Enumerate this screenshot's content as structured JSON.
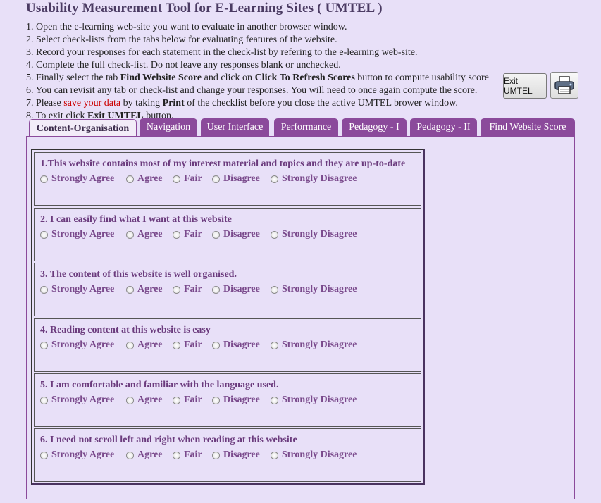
{
  "title": "Usability Measurement Tool for E-Learning Sites ( UMTEL )",
  "instructions": {
    "l1": "1. Open the e-learning web-site you want to evaluate in another browser window.",
    "l2": "2. Select check-lists from the tabs below for evaluating features of the website.",
    "l3": "3. Record your responses for each statement in the check-list by refering to the e-learning web-site.",
    "l4": "4. Complete the full check-list. Do not leave any responses blank or unchecked.",
    "l5a": "5. Finally select the tab ",
    "l5b": "Find Website Score",
    "l5c": " and click on ",
    "l5d": "Click To Refresh Scores",
    "l5e": " button to compute usability score",
    "l6": "6. You can revisit any tab or check-list and change your responses. You will need to once again compute the score.",
    "l7a": "7. Please ",
    "l7b": "save your data",
    "l7c": " by taking ",
    "l7d": "Print",
    "l7e": " of the checklist before you close the active UMTEL brower window.",
    "l8a": "8. To exit click ",
    "l8b": "Exit UMTEL",
    "l8c": " button."
  },
  "buttons": {
    "exit": "Exit UMTEL",
    "print_icon": "printer-icon"
  },
  "tabs": [
    "Content-Organisation",
    "Navigation",
    "User Interface",
    "Performance",
    "Pedagogy - I",
    "Pedagogy - II",
    "Find Website Score"
  ],
  "active_tab": "Content-Organisation",
  "options": [
    "Strongly Agree",
    "Agree",
    "Fair",
    "Disagree",
    "Strongly Disagree"
  ],
  "questions": [
    "1.This website contains most of my interest material and topics and they are up-to-date",
    "2. I can easily find what I want at this website",
    "3. The content of this website is well organised.",
    "4. Reading content at this website is easy",
    "5. I am comfortable and familiar with the language used.",
    "6. I need not scroll left and right when reading at this website"
  ],
  "colors": {
    "tab": "#8b4a9b",
    "background": "#e8e0f8",
    "question_text": "#6b3b7d",
    "highlight": "#cc0000"
  }
}
